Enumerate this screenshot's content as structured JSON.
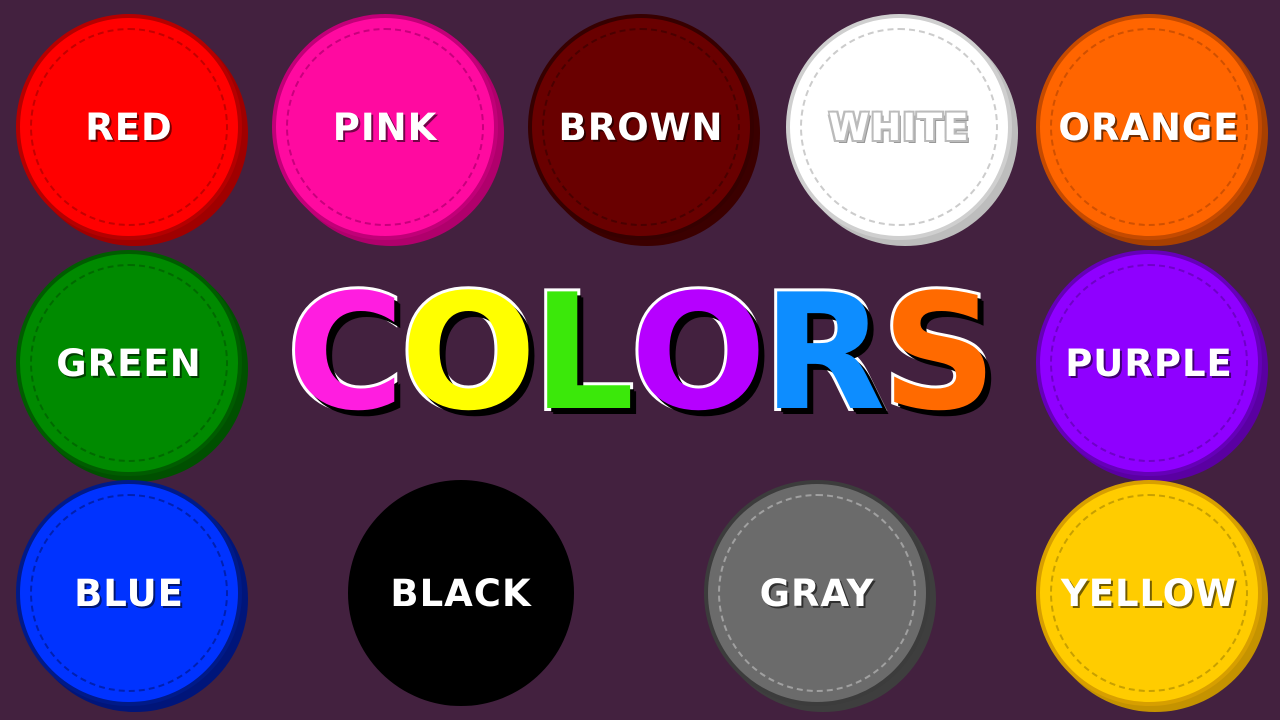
{
  "background": "#43213f",
  "title": {
    "letters": [
      {
        "char": "C",
        "color": "#ff1de0"
      },
      {
        "char": "O",
        "color": "#ffff00"
      },
      {
        "char": "L",
        "color": "#3be80a"
      },
      {
        "char": "O",
        "color": "#b600ff"
      },
      {
        "char": "R",
        "color": "#0d8dff"
      },
      {
        "char": "S",
        "color": "#ff6a00"
      }
    ]
  },
  "colors": [
    {
      "label": "RED",
      "fill": "#ff0000",
      "edge": "#b50000",
      "stitch": "#c40000",
      "shadow": "#a00000"
    },
    {
      "label": "PINK",
      "fill": "#ff0aa0",
      "edge": "#c10078",
      "stitch": "#c8007d",
      "shadow": "#b0006c"
    },
    {
      "label": "BROWN",
      "fill": "#690000",
      "edge": "#360000",
      "stitch": "#4a0000",
      "shadow": "#3b0000"
    },
    {
      "label": "WHITE",
      "fill": "#ffffff",
      "edge": "#cfcfcf",
      "stitch": "#cccccc",
      "shadow": "#bdbdbd",
      "text": "#ffffff",
      "text_stroke": "#bbbbbb"
    },
    {
      "label": "ORANGE",
      "fill": "#ff6500",
      "edge": "#c44a00",
      "stitch": "#d05000",
      "shadow": "#a84000"
    },
    {
      "label": "GREEN",
      "fill": "#008a00",
      "edge": "#005c00",
      "stitch": "#006a00",
      "shadow": "#005000"
    },
    {
      "label": "PURPLE",
      "fill": "#8f00ff",
      "edge": "#6500b8",
      "stitch": "#6f00c8",
      "shadow": "#5a00a2"
    },
    {
      "label": "BLUE",
      "fill": "#0033ff",
      "edge": "#001a88",
      "stitch": "#0020b0",
      "shadow": "#00157a"
    },
    {
      "label": "BLACK",
      "fill": "#000000",
      "edge": "#000000",
      "stitch": "#000000",
      "shadow": "#000000"
    },
    {
      "label": "GRAY",
      "fill": "#6b6b6b",
      "edge": "#3c3c3c",
      "stitch": "#a0a0a0",
      "shadow": "#3e3e3e"
    },
    {
      "label": "YELLOW",
      "fill": "#ffcc00",
      "edge": "#d79f00",
      "stitch": "#c8a000",
      "shadow": "#c59300"
    }
  ]
}
